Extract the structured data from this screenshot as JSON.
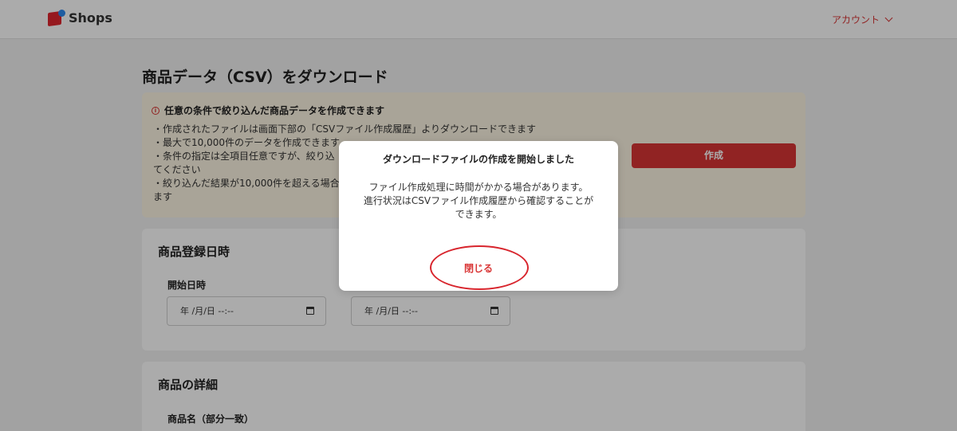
{
  "header": {
    "logo_text": "Shops",
    "account_label": "アカウント"
  },
  "page": {
    "title": "商品データ（CSV）をダウンロード"
  },
  "notice": {
    "heading": "任意の条件で絞り込んだ商品データを作成できます",
    "lines": [
      "・作成されたファイルは画面下部の「CSVファイル作成履歴」よりダウンロードできます",
      "・最大で10,000件のデータを作成できます",
      "・条件の指定は全項目任意ですが、絞り込",
      "てください",
      "・絞り込んだ結果が10,000件を超える場合",
      "ます"
    ],
    "create_button": "作成"
  },
  "registration_card": {
    "title": "商品登録日時",
    "start_label": "開始日時",
    "start_value": "年 /月/日 --:--",
    "end_value": "年 /月/日 --:--"
  },
  "details_card": {
    "title": "商品の詳細",
    "name_label": "商品名（部分一致）"
  },
  "modal": {
    "title": "ダウンロードファイルの作成を開始しました",
    "body_lines": [
      "ファイル作成処理に時間がかかる場合があります。",
      "進行状況はCSVファイル作成履歴から確認することが",
      "できます。"
    ],
    "close_button": "閉じる"
  },
  "colors": {
    "accent": "#d93535",
    "notice_bg": "#fdf5e3",
    "highlight_ring": "#d8252d"
  }
}
